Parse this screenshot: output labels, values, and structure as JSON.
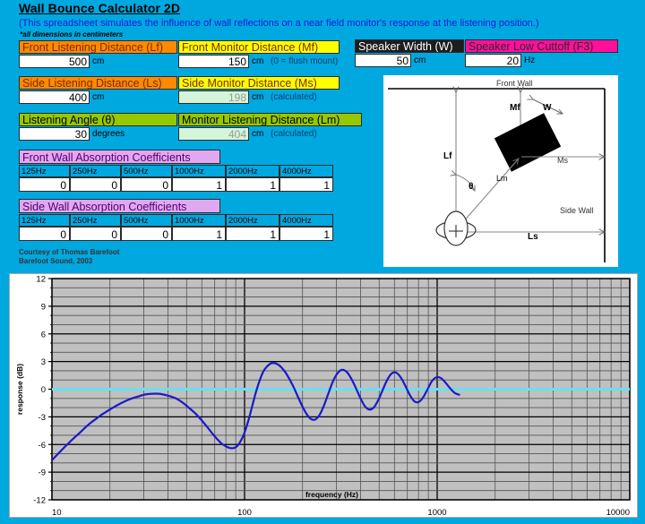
{
  "header": {
    "title": "Wall Bounce Calculator 2D",
    "subtitle": "(This spreadsheet simulates the influence of wall reflections on a near field monitor's response at the listening position.)",
    "note": "*all dimensions in centimeters"
  },
  "inputs": {
    "lf": {
      "label": "Front Listening Distance (Lf)",
      "value": "500",
      "unit": "cm"
    },
    "mf": {
      "label": "Front Monitor Distance (Mf)",
      "value": "150",
      "unit": "cm",
      "hint": "(0 = flush mount)"
    },
    "w": {
      "label": "Speaker Width (W)",
      "value": "50",
      "unit": "cm"
    },
    "f3": {
      "label": "Speaker Low Cuttoff (F3)",
      "value": "20",
      "unit": "Hz"
    },
    "ls": {
      "label": "Side Listening Distance (Ls)",
      "value": "400",
      "unit": "cm"
    },
    "ms": {
      "label": "Side Monitor Distance (Ms)",
      "value": "198",
      "unit": "cm",
      "hint": "(calculated)"
    },
    "theta": {
      "label": "Listening Angle (θ)",
      "value": "30",
      "unit": "degrees"
    },
    "lm": {
      "label": "Monitor Listening Distance (Lm)",
      "value": "404",
      "unit": "cm",
      "hint": "(calculated)"
    }
  },
  "front_wall_absorption": {
    "title": "Front Wall Absorption Coefficients",
    "bands": [
      "125Hz",
      "250Hz",
      "500Hz",
      "1000Hz",
      "2000Hz",
      "4000Hz"
    ],
    "values": [
      "0",
      "0",
      "0",
      "1",
      "1",
      "1"
    ]
  },
  "side_wall_absorption": {
    "title": "Side Wall Absorption Coefficients",
    "bands": [
      "125Hz",
      "250Hz",
      "500Hz",
      "1000Hz",
      "2000Hz",
      "4000Hz"
    ],
    "values": [
      "0",
      "0",
      "0",
      "1",
      "1",
      "1"
    ]
  },
  "credit": {
    "line1": "Courtesy of Thomas Barefoot",
    "line2": "Barefoot Sound, 2003"
  },
  "diagram": {
    "front_wall": "Front Wall",
    "side_wall": "Side Wall",
    "lf": "Lf",
    "ls": "Ls",
    "lm": "Lm",
    "mf": "Mf",
    "ms": "Ms",
    "w": "W",
    "theta": "θ"
  },
  "colors": {
    "page_background": "#00a8e0",
    "orange": "#ff8a00",
    "yellow": "#ffff00",
    "pink": "#ff0f9b",
    "olive": "#96c800",
    "violet": "#e0a8f0",
    "curve": "#1a1ac8",
    "zero_line": "#66e0f5",
    "plot_background": "#c0c0c0"
  },
  "chart_data": {
    "type": "line",
    "title": "",
    "xlabel": "frequency (Hz)",
    "ylabel": "response (dB)",
    "xscale": "log",
    "xlim": [
      10,
      10000
    ],
    "ylim": [
      -12,
      12
    ],
    "xticks": [
      10,
      100,
      1000,
      10000
    ],
    "xticklabels": [
      "10",
      "100",
      "1000",
      "10000"
    ],
    "yticks": [
      -12,
      -9,
      -6,
      -3,
      0,
      3,
      6,
      9,
      12
    ],
    "yticklabels": [
      "-12",
      "-9",
      "-6",
      "-3",
      "0",
      "3",
      "6",
      "9",
      "12"
    ],
    "grid": true,
    "legend": false,
    "reference_line": {
      "y": 0,
      "color": "#66e0f5"
    },
    "series": [
      {
        "name": "response",
        "color": "#1a1ac8",
        "x": [
          10,
          11,
          12,
          13,
          14,
          15,
          16,
          17,
          18,
          19,
          20,
          22,
          24,
          26,
          28,
          30,
          33,
          36,
          40,
          44,
          48,
          52,
          56,
          60,
          64,
          68,
          72,
          76,
          80,
          85,
          90,
          95,
          100,
          105,
          110,
          115,
          120,
          125,
          130,
          137,
          145,
          153,
          162,
          171,
          180,
          190,
          200,
          210,
          220,
          232,
          245,
          258,
          272,
          287,
          303,
          320,
          338,
          357,
          377,
          398,
          420,
          443,
          468,
          494,
          521,
          550,
          580,
          612,
          646,
          682,
          720,
          760,
          800,
          845,
          892,
          941,
          993,
          1048,
          1106,
          1167,
          1232,
          1300
        ],
        "y": [
          -7.7,
          -6.8,
          -6.0,
          -5.3,
          -4.7,
          -4.1,
          -3.6,
          -3.2,
          -2.8,
          -2.5,
          -2.2,
          -1.7,
          -1.3,
          -1.0,
          -0.8,
          -0.6,
          -0.5,
          -0.5,
          -0.7,
          -1.0,
          -1.5,
          -2.1,
          -2.7,
          -3.4,
          -4.1,
          -4.8,
          -5.4,
          -5.9,
          -6.2,
          -6.4,
          -6.3,
          -5.7,
          -4.7,
          -3.3,
          -1.7,
          -0.2,
          1.0,
          1.9,
          2.4,
          2.8,
          2.8,
          2.5,
          1.9,
          1.1,
          0.2,
          -0.9,
          -1.9,
          -2.7,
          -3.2,
          -3.3,
          -2.8,
          -1.8,
          -0.5,
          0.8,
          1.7,
          2.1,
          1.9,
          1.2,
          0.2,
          -0.9,
          -1.8,
          -2.2,
          -2.0,
          -1.2,
          -0.1,
          1.0,
          1.7,
          1.8,
          1.3,
          0.4,
          -0.6,
          -1.3,
          -1.4,
          -0.9,
          0.0,
          0.9,
          1.3,
          1.2,
          0.7,
          0.1,
          -0.4,
          -0.6
        ],
        "note": "Decaying comb-filter ripple converging to 0 dB above ~1 kHz"
      }
    ]
  }
}
